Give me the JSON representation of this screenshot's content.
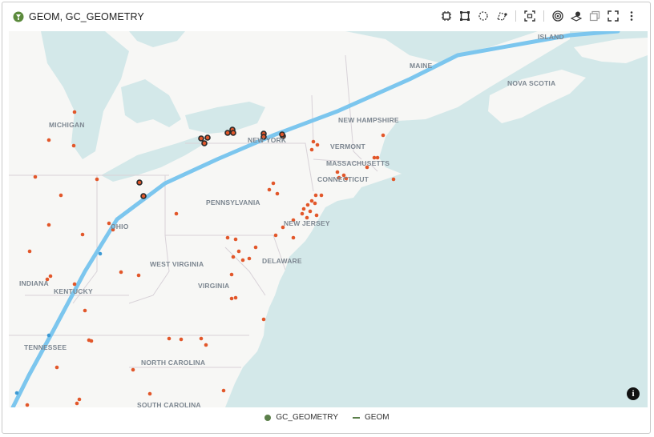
{
  "header": {
    "title": "GEOM, GC_GEOMETRY",
    "icon": "layer-globe-icon",
    "toolbar": [
      {
        "name": "select-point-tool",
        "icon": "chip-icon"
      },
      {
        "name": "select-rectangle-tool",
        "icon": "square-select-icon"
      },
      {
        "name": "select-circle-tool",
        "icon": "circle-dashed-icon"
      },
      {
        "name": "select-polygon-tool",
        "icon": "polygon-select-icon"
      },
      {
        "name": "zoom-to-fit-tool",
        "icon": "zoom-fit-icon"
      },
      {
        "name": "target-tool",
        "icon": "target-icon"
      },
      {
        "name": "layers-tool",
        "icon": "layers-icon"
      },
      {
        "name": "copy-tool",
        "icon": "copy-icon"
      },
      {
        "name": "fullscreen-tool",
        "icon": "fullscreen-icon"
      },
      {
        "name": "more-tool",
        "icon": "kebab-icon"
      }
    ]
  },
  "map": {
    "labels": {
      "island": "ISLAND",
      "maine": "MAINE",
      "nova_scotia": "NOVA SCOTIA",
      "michigan": "MICHIGAN",
      "new_hampshire": "NEW HAMPSHIRE",
      "new_york": "NEW YORK",
      "vermont": "VERMONT",
      "massachusetts": "MASSACHUSETTS",
      "connecticut": "CONNECTICUT",
      "pennsylvania": "PENNSYLVANIA",
      "ohio": "OHIO",
      "new_jersey": "NEW JERSEY",
      "west_virginia": "WEST VIRGINIA",
      "delaware": "DELAWARE",
      "indiana": "INDIANA",
      "kentucky": "KENTUCKY",
      "virginia": "VIRGINIA",
      "tennessee": "TENNESSEE",
      "north_carolina": "NORTH CAROLINA",
      "south_carolina": "SOUTH CAROLINA"
    },
    "colors": {
      "water": "#d3e8e9",
      "land": "#f7f7f5",
      "border": "#d8d2d8",
      "route": "#7cc6ee",
      "point": "#e2572a",
      "selected_point_ring": "#2a2a2a"
    }
  },
  "info_button": "i",
  "legend": [
    {
      "label": "GC_GEOMETRY",
      "kind": "point",
      "color": "#5b7f4a"
    },
    {
      "label": "GEOM",
      "kind": "line",
      "color": "#5b7f4a"
    }
  ]
}
